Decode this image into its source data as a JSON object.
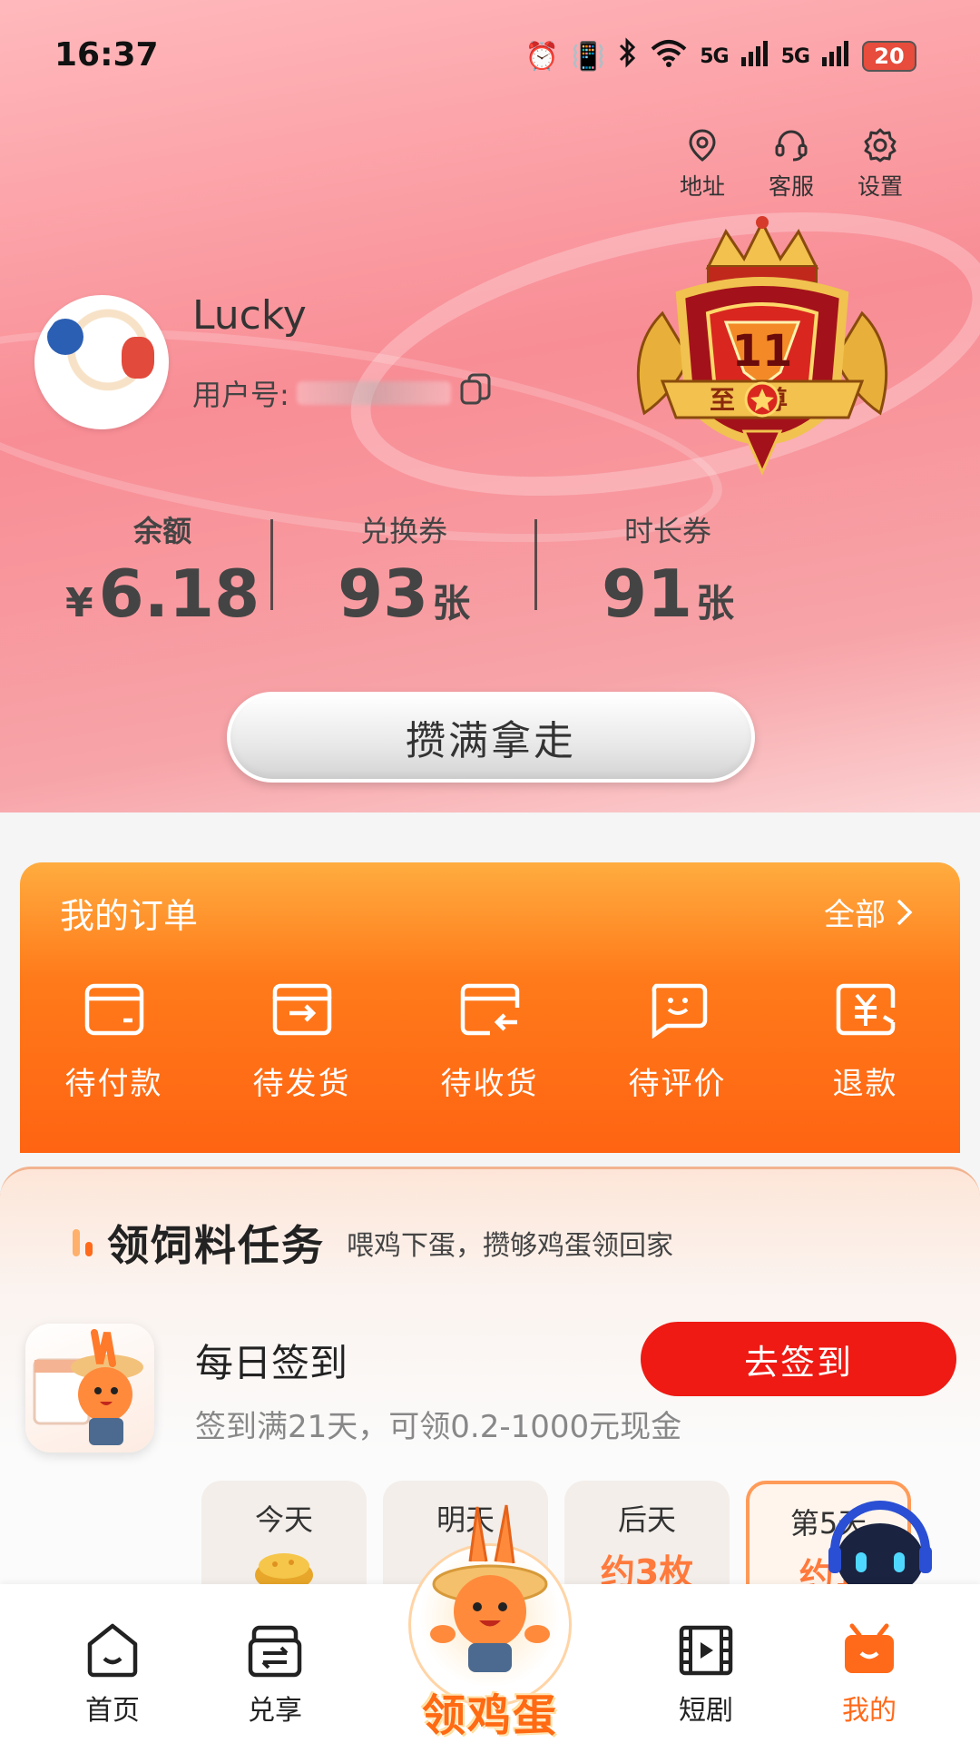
{
  "status_bar": {
    "time": "16:37",
    "signal1": "5G",
    "signal2": "5G",
    "battery": "20"
  },
  "top_actions": [
    {
      "label": "地址",
      "icon": "location-pin-icon"
    },
    {
      "label": "客服",
      "icon": "headset-icon"
    },
    {
      "label": "设置",
      "icon": "gear-icon"
    }
  ],
  "profile": {
    "username": "Lucky",
    "userid_label": "用户号:",
    "badge_level": "11",
    "badge_title": "至尊"
  },
  "stats": {
    "balance": {
      "label": "余额",
      "currency": "¥",
      "value": "6.18"
    },
    "vouchers": {
      "label": "兑换券",
      "value": "93",
      "unit": "张"
    },
    "time_vouchers": {
      "label": "时长券",
      "value": "91",
      "unit": "张"
    }
  },
  "hero_button": "攒满拿走",
  "orders": {
    "title": "我的订单",
    "all_label": "全部",
    "items": [
      {
        "label": "待付款",
        "icon": "wallet-icon"
      },
      {
        "label": "待发货",
        "icon": "ship-box-icon"
      },
      {
        "label": "待收货",
        "icon": "receive-box-icon"
      },
      {
        "label": "待评价",
        "icon": "review-chat-icon"
      },
      {
        "label": "退款",
        "icon": "refund-icon"
      }
    ]
  },
  "tasks": {
    "title": "领饲料任务",
    "subtitle": "喂鸡下蛋，攒够鸡蛋领回家",
    "checkin": {
      "title": "每日签到",
      "desc": "签到满21天，可领0.2-1000元现金",
      "button": "去签到"
    },
    "days": [
      {
        "label": "今天",
        "reward": ""
      },
      {
        "label": "明天",
        "reward": ""
      },
      {
        "label": "后天",
        "reward": "约3枚"
      },
      {
        "label": "第5天",
        "reward": "约1"
      }
    ]
  },
  "bottom_nav": {
    "items": [
      {
        "label": "首页",
        "icon": "home-icon"
      },
      {
        "label": "兑享",
        "icon": "exchange-icon"
      },
      {
        "label": "领鸡蛋",
        "icon": "mascot-icon"
      },
      {
        "label": "短剧",
        "icon": "film-icon"
      },
      {
        "label": "我的",
        "icon": "gift-box-icon"
      }
    ]
  },
  "colors": {
    "accent": "#ff6a1a",
    "checkin_button": "#ee1a13",
    "hero_gradient_start": "#ffb9bc",
    "hero_gradient_end": "#f88d95"
  }
}
